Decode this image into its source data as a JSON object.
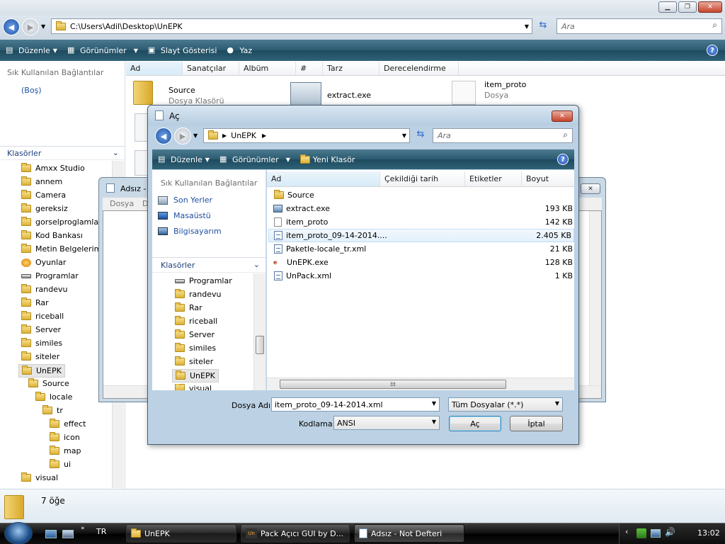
{
  "explorer": {
    "address": "C:\\Users\\Adil\\Desktop\\UnEPK",
    "search_placeholder": "Ara",
    "toolbar": {
      "organize": "Düzenle",
      "views": "Görünümler",
      "slideshow": "Slayt Gösterisi",
      "write": "Yaz"
    },
    "favorites_header": "Sık Kullanılan Bağlantılar",
    "favorites_empty": "(Boş)",
    "folders_header": "Klasörler",
    "tree": [
      "Amxx Studio",
      "annem",
      "Camera",
      "gereksiz",
      "gorselproglamlar",
      "Kod Bankası",
      "Metin Belgelerim",
      "Oyunlar",
      "Programlar",
      "randevu",
      "Rar",
      "riceball",
      "Server",
      "similes",
      "siteler",
      "UnEPK",
      "Source",
      "locale",
      "tr",
      "effect",
      "icon",
      "map",
      "ui",
      "visual"
    ],
    "columns": [
      "Ad",
      "Sanatçılar",
      "Albüm",
      "#",
      "Tarz",
      "Derecelendirme"
    ],
    "tiles": [
      {
        "name": "Source",
        "sub": "Dosya Klasörü"
      },
      {
        "name": "extract.exe",
        "sub": ""
      },
      {
        "name": "item_proto",
        "sub": "Dosya"
      }
    ],
    "status_count": "7 öğe"
  },
  "notepad": {
    "title": "Adsız - Not Defteri",
    "title_short": "Adsız -",
    "menu_file": "Dosya",
    "menu_edit": "D"
  },
  "dialog": {
    "title": "Aç",
    "breadcrumb": "UnEPK",
    "search_placeholder": "Ara",
    "toolbar": {
      "organize": "Düzenle",
      "views": "Görünümler",
      "new_folder": "Yeni Klasör"
    },
    "favorites_header": "Sık Kullanılan Bağlantılar",
    "favorites": [
      "Son Yerler",
      "Masaüstü",
      "Bilgisayarım"
    ],
    "folders_header": "Klasörler",
    "tree": [
      "Programlar",
      "randevu",
      "Rar",
      "riceball",
      "Server",
      "similes",
      "siteler",
      "UnEPK",
      "visual"
    ],
    "columns": [
      "Ad",
      "Çekildiği tarih",
      "Etiketler",
      "Boyut"
    ],
    "files": [
      {
        "name": "Source",
        "size": "",
        "icon": "folder"
      },
      {
        "name": "extract.exe",
        "size": "193 KB",
        "icon": "exe"
      },
      {
        "name": "item_proto",
        "size": "142 KB",
        "icon": "file"
      },
      {
        "name": "item_proto_09-14-2014....",
        "size": "2.405 KB",
        "icon": "xml"
      },
      {
        "name": "Paketle-locale_tr.xml",
        "size": "21 KB",
        "icon": "xml"
      },
      {
        "name": "UnEPK.exe",
        "size": "128 KB",
        "icon": "exe"
      },
      {
        "name": "UnPack.xml",
        "size": "1 KB",
        "icon": "xml"
      }
    ],
    "filename_label": "Dosya Adı:",
    "filename_value": "item_proto_09-14-2014.xml",
    "filetype_value": "Tüm Dosyalar  (*.*)",
    "encoding_label": "Kodlama:",
    "encoding_value": "ANSI",
    "open_button": "Aç",
    "cancel_button": "İptal"
  },
  "taskbar": {
    "lang": "TR",
    "items": [
      "UnEPK",
      "Pack Açıcı GUI by D...",
      "Adsız - Not Defteri"
    ],
    "clock": "13:02"
  }
}
